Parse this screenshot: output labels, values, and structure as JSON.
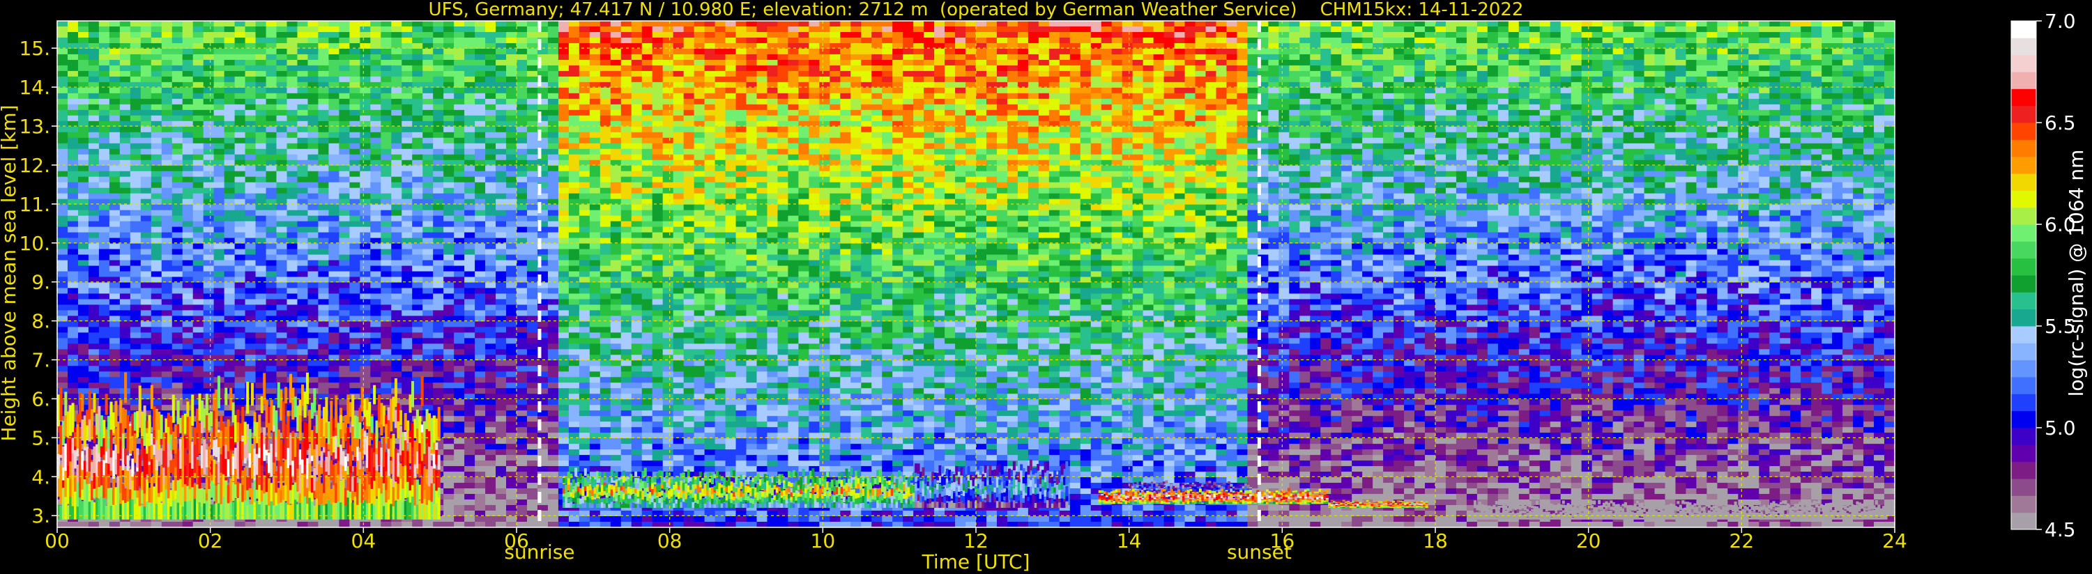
{
  "chart_data": {
    "type": "heatmap",
    "title": "UFS, Germany; 47.417 N / 10.980 E; elevation: 2712 m  (operated by German Weather Service)    CHM15kx: 14-11-2022",
    "xlabel": "Time [UTC]",
    "ylabel": "Height above mean sea level [km]",
    "xlim": [
      0,
      24
    ],
    "ylim": [
      2.7,
      15.7
    ],
    "x_ticks": [
      "00",
      "02",
      "04",
      "06",
      "08",
      "10",
      "12",
      "14",
      "16",
      "18",
      "20",
      "22",
      "24"
    ],
    "y_ticks": [
      "3.",
      "4.",
      "5.",
      "6.",
      "7.",
      "8.",
      "9.",
      "10.",
      "11.",
      "12.",
      "13.",
      "14.",
      "15."
    ],
    "grid": true,
    "colorbar": {
      "label": "log(rc-signal) @ 1064 nm",
      "range": [
        4.5,
        7.0
      ],
      "ticks": [
        "4.5",
        "5.0",
        "5.5",
        "6.0",
        "6.5",
        "7.0"
      ],
      "levels": [
        "#a8a0a8",
        "#a07898",
        "#8c4c8c",
        "#7c1c84",
        "#6000ac",
        "#3c00c8",
        "#0000f0",
        "#2040ff",
        "#4070ff",
        "#6494ff",
        "#88b4ff",
        "#a8ccff",
        "#18a890",
        "#28c08c",
        "#10a030",
        "#28c040",
        "#48d860",
        "#70f070",
        "#a8f048",
        "#e0f800",
        "#f0d800",
        "#ff9c00",
        "#ff7c00",
        "#ff4400",
        "#ee2020",
        "#ff0000",
        "#f0b0b0",
        "#f4d0d0",
        "#e8e0e0",
        "#ffffff"
      ]
    },
    "annotations": [
      {
        "text": "sunrise",
        "x": 6.3
      },
      {
        "text": "sunset",
        "x": 15.7
      }
    ],
    "cloud_layers": [
      {
        "x0": 0.0,
        "x1": 5.0,
        "bottom": 2.9,
        "top": 6.5,
        "max_signal": 7.0
      },
      {
        "x0": 6.6,
        "x1": 11.2,
        "bottom": 3.2,
        "top": 4.2,
        "max_signal": 6.5
      },
      {
        "x0": 11.2,
        "x1": 13.2,
        "bottom": 3.2,
        "top": 4.4,
        "max_signal": 5.8
      },
      {
        "x0": 14.0,
        "x1": 15.6,
        "bottom": 3.5,
        "top": 3.9,
        "max_signal": 5.5
      },
      {
        "x0": 13.6,
        "x1": 16.6,
        "bottom": 3.3,
        "top": 3.7,
        "max_signal": 7.0
      },
      {
        "x0": 16.6,
        "x1": 17.9,
        "bottom": 3.2,
        "top": 3.4,
        "max_signal": 7.0
      },
      {
        "x0": 18.5,
        "x1": 23.9,
        "bottom": 2.9,
        "top": 3.4,
        "max_signal": 4.8
      }
    ],
    "colors": {
      "axis_text": "#f0e000",
      "grid": "#e0e000",
      "sun_line": "#ffffff",
      "background": "#000000"
    }
  }
}
